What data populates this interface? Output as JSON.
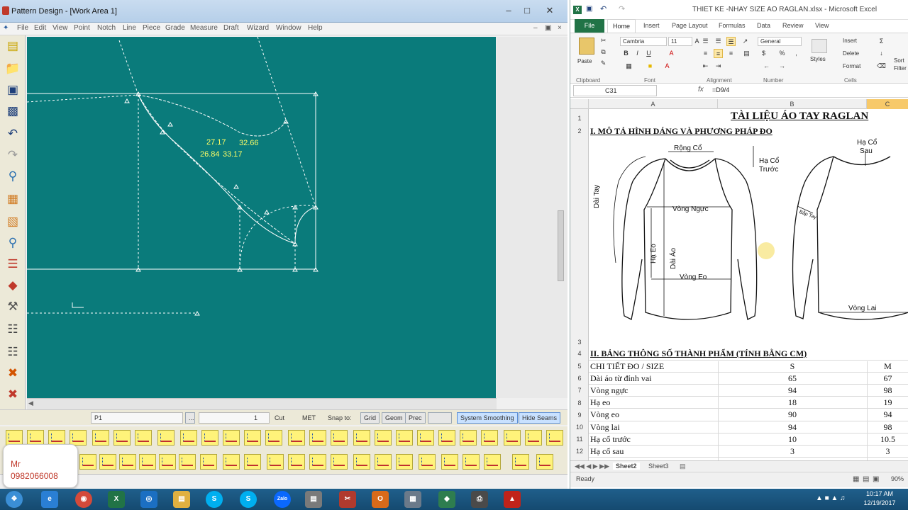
{
  "pattern_design": {
    "title": "Pattern Design - [Work Area 1]",
    "menu": [
      "File",
      "Edit",
      "View",
      "Point",
      "Notch",
      "Line",
      "Piece",
      "Grade",
      "Measure",
      "Draft",
      "Wizard",
      "Window",
      "Help"
    ],
    "canvas_labels": [
      "27.17",
      "32.66",
      "26.84",
      "33.17"
    ],
    "status": {
      "point": "P1",
      "dots": "...",
      "value": "1",
      "cut": "Cut",
      "units": "MET",
      "snap_to": "Snap to:",
      "grid": "Grid",
      "geom": "Geom",
      "prec": "Prec",
      "system_smoothing": "System Smoothing",
      "hide_seams": "Hide Seams"
    }
  },
  "contact": {
    "line1": "Mr",
    "line2": "0982066008"
  },
  "excel": {
    "title": "THIET KE -NHAY SIZE AO RAGLAN.xlsx - Microsoft Excel",
    "tabs": {
      "file": "File",
      "home": "Home",
      "insert": "Insert",
      "page_layout": "Page Layout",
      "formulas": "Formulas",
      "data": "Data",
      "review": "Review",
      "view": "View"
    },
    "ribbon": {
      "paste": "Paste",
      "font_name": "Cambria",
      "font_size": "11",
      "number_format": "General",
      "styles": "Styles",
      "insert": "Insert",
      "delete": "Delete",
      "format": "Format",
      "sort": "Sort",
      "filter": "Filter",
      "groups": {
        "clipboard": "Clipboard",
        "font": "Font",
        "alignment": "Alignment",
        "number": "Number",
        "cells": "Cells"
      }
    },
    "name_box": "C31",
    "formula": "=D9/4",
    "columns": [
      "A",
      "B",
      "C"
    ],
    "rows": [
      "1",
      "2",
      "3",
      "4",
      "5",
      "6",
      "7",
      "8",
      "9",
      "10",
      "11",
      "12"
    ],
    "title_cell": "TÀI LIỆU ÁO TAY RAGLAN",
    "section1": "I. MÔ TẢ HÌNH DÁNG VÀ PHƯƠNG PHÁP ĐO",
    "section2": "II. BẢNG THÔNG SỐ THÀNH PHẨM (TÍNH BẰNG CM)",
    "diagram_labels": {
      "rong_co": "Rộng Cổ",
      "ha_co_truoc_1": "Hạ Cổ",
      "ha_co_truoc_2": "Trước",
      "ha_co_sau_1": "Hạ Cổ",
      "ha_co_sau_2": "Sau",
      "dai_tay": "Dài Tay",
      "vong_nguc": "Vòng Ngực",
      "ha_eo": "Hạ Eo",
      "dai_ao": "Dài Áo",
      "vong_eo": "Vòng Eo",
      "bap_tay": "Bắp Tay",
      "vong_lai": "Vòng Lai"
    },
    "table": {
      "header": {
        "label": "CHI TIẾT ĐO / SIZE",
        "s": "S",
        "m": "M"
      },
      "rows": [
        {
          "label": "Dài áo từ đỉnh vai",
          "s": "65",
          "m": "67"
        },
        {
          "label": "Vòng ngực",
          "s": "94",
          "m": "98"
        },
        {
          "label": "Hạ eo",
          "s": "18",
          "m": "19"
        },
        {
          "label": "Vòng eo",
          "s": "90",
          "m": "94"
        },
        {
          "label": "Vòng lai",
          "s": "94",
          "m": "98"
        },
        {
          "label": "Hạ cổ trước",
          "s": "10",
          "m": "10.5"
        },
        {
          "label": "Hạ cổ sau",
          "s": "3",
          "m": "3"
        }
      ]
    },
    "sheet_tabs": [
      "Sheet2",
      "Sheet3"
    ],
    "status": "Ready",
    "zoom": "90%"
  },
  "taskbar": {
    "time": "10:17 AM",
    "date": "12/19/2017"
  },
  "colors": {
    "canvas": "#0a7b7b",
    "excel_green": "#217346",
    "taskbar": "#1f5f8b"
  }
}
